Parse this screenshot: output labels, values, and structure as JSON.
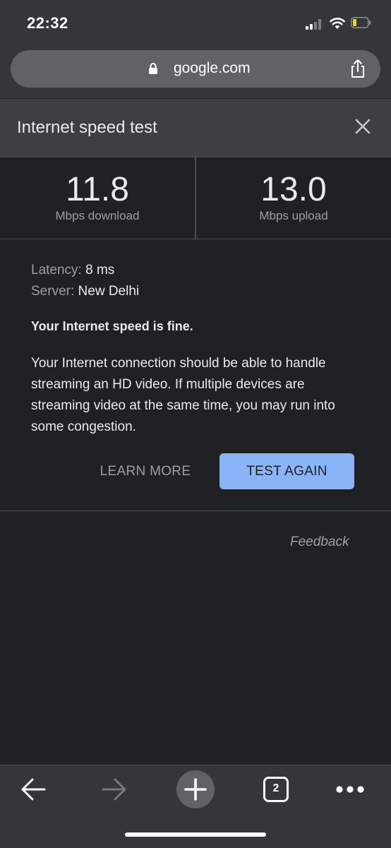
{
  "status_bar": {
    "time": "22:32",
    "icons": [
      "cellular-signal-icon",
      "wifi-icon",
      "battery-low-icon"
    ]
  },
  "address_bar": {
    "url": "google.com",
    "icons": [
      "lock-icon",
      "share-icon"
    ]
  },
  "speed_test": {
    "title": "Internet speed test",
    "download": {
      "value": "11.8",
      "unit": "Mbps download"
    },
    "upload": {
      "value": "13.0",
      "unit": "Mbps upload"
    },
    "latency": {
      "label": "Latency:",
      "value": "8 ms"
    },
    "server": {
      "label": "Server:",
      "value": "New Delhi"
    },
    "verdict": "Your Internet speed is fine.",
    "description": "Your Internet connection should be able to handle streaming an HD video. If multiple devices are streaming video at the same time, you may run into some congestion.",
    "learn_more_label": "LEARN MORE",
    "test_again_label": "TEST AGAIN",
    "feedback_label": "Feedback"
  },
  "toolbar": {
    "tab_count": "2",
    "icons": [
      "back-arrow-icon",
      "forward-arrow-icon",
      "new-tab-plus-icon",
      "tab-switcher-icon",
      "more-menu-icon"
    ]
  },
  "colors": {
    "page_bg": "#202124",
    "chrome_bg": "#35363a",
    "card_header_bg": "#3c4043",
    "accent_button": "#8ab4f8",
    "primary_text": "#e8eaed",
    "secondary_text": "#9aa0a6"
  }
}
